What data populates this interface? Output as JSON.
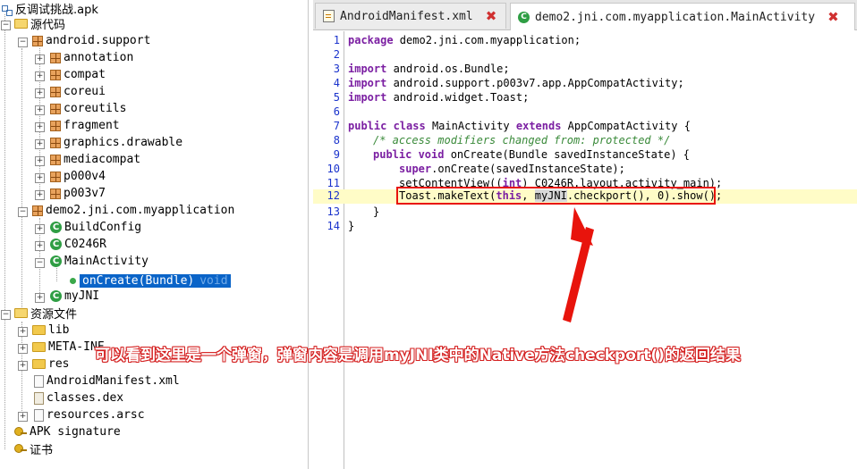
{
  "tree": {
    "root": "反调试挑战.apk",
    "source": "源代码",
    "support_pkg": "android.support",
    "support_children": [
      "annotation",
      "compat",
      "coreui",
      "coreutils",
      "fragment",
      "graphics.drawable",
      "mediacompat",
      "p000v4",
      "p003v7"
    ],
    "app_pkg": "demo2.jni.com.myapplication",
    "classes": [
      "BuildConfig",
      "C0246R",
      "MainActivity"
    ],
    "method_name": "onCreate(Bundle)",
    "method_return": "void",
    "myjni": "myJNI",
    "resources": "资源文件",
    "res_children": [
      "lib",
      "META-INF",
      "res",
      "AndroidManifest.xml",
      "classes.dex",
      "resources.arsc"
    ],
    "apk_signature": "APK signature",
    "certificate": "证书"
  },
  "tabs": [
    {
      "label": "AndroidManifest.xml"
    },
    {
      "label": "demo2.jni.com.myapplication.MainActivity"
    }
  ],
  "code": {
    "lines": [
      "1",
      "2",
      "3",
      "4",
      "5",
      "6",
      "7",
      "8",
      "9",
      "10",
      "11",
      "12",
      "13",
      "14"
    ],
    "l1_kw": "package",
    "l1_rest": " demo2.jni.com.myapplication;",
    "import_kw": "import",
    "l3_rest": " android.os.Bundle;",
    "l4_rest": " android.support.p003v7.app.AppCompatActivity;",
    "l5_rest": " android.widget.Toast;",
    "l7_public": "public",
    "l7_class": " class",
    "l7_name": " MainActivity ",
    "l7_extends": "extends",
    "l7_rest": " AppCompatActivity {",
    "l8_comment": "/* access modifiers changed from: protected */",
    "l9_public": "public",
    "l9_void": " void",
    "l9_rest": " onCreate(Bundle savedInstanceState) {",
    "l10_super": "super",
    "l10_rest": ".onCreate(savedInstanceState);",
    "l11_a": "setContentView((",
    "l11_int": "int",
    "l11_b": ") C0246R.layout.activity_main);",
    "l12_a": "Toast.makeText(",
    "l12_this": "this",
    "l12_b": ", ",
    "l12_myjni": "myJNI",
    "l12_c": ".checkport(), 0).show();",
    "l13": "}",
    "l14": "}"
  },
  "annotation": {
    "text": "可以看到这里是一个弹窗，弹窗内容是调用myJNI类中的Native方法checkport()的返回结果",
    "color": "#d42020"
  }
}
